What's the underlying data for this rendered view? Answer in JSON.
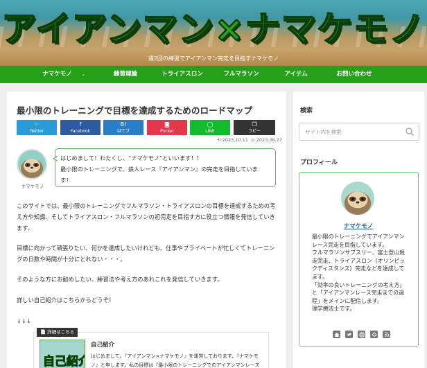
{
  "site": {
    "title": "アイアンマン×ナマケモノ",
    "tagline": "週2回の練習でアイアンマン完走を目指すナマケモノ"
  },
  "nav": {
    "items": [
      {
        "label": "ナマケモノ",
        "caret": "⌄"
      },
      {
        "label": "練習理論"
      },
      {
        "label": "トライアスロン"
      },
      {
        "label": "フルマラソン"
      },
      {
        "label": "アイテム"
      },
      {
        "label": "お問い合わせ"
      }
    ]
  },
  "post": {
    "title": "最小限のトレーニングで目標を達成するためのロードマップ",
    "share": [
      {
        "icon": "twitter-icon",
        "glyph": "🐦",
        "label": "Twitter",
        "color": "#2a9bd8"
      },
      {
        "icon": "facebook-icon",
        "glyph": "f",
        "label": "Facebook",
        "color": "#2d5aa0"
      },
      {
        "icon": "hatebu-icon",
        "glyph": "B!",
        "label": "はてブ",
        "color": "#2a7ec8"
      },
      {
        "icon": "pocket-icon",
        "glyph": "◙",
        "label": "Pocket",
        "color": "#e2374c"
      },
      {
        "icon": "line-icon",
        "glyph": "◯",
        "label": "LINE",
        "color": "#11bb2b"
      },
      {
        "icon": "copy-icon",
        "glyph": "❐",
        "label": "コピー",
        "color": "#333333"
      }
    ],
    "posted_date": "2023.10.11",
    "updated_date": "2023.08.27",
    "author_name": "ナマケモノ",
    "balloon_text_1": "はじめまして！わたくし、“ナマケモノ”といいます！！",
    "balloon_text_2": "最小限のトレーニングで、鉄人レース『アイアンマン』の完走を目指していま",
    "balloon_text_3": "す！",
    "paragraphs": [
      "このサイトでは、最小限のトレーニングでフルマラソン・トライアスロンの目標を達成するための考え方や知識、そしてトライアスロン・フルマラソンの初完走を目指す方に役立つ情報を発信していきます。",
      "目標に向かって頑張りたい、何かを達成したいけれども、仕事やプライベートが忙しくてトレーニングの日数や時間が十分にとれない・・・。",
      "そのような方にお勧めしたい、練習法や考え方のあれこれを発信していきます。",
      "詳しい自己紹介はこちらからどうぞ！",
      "↓↓↓"
    ],
    "blogcard": {
      "tag": "📄 詳細はこちら",
      "thumb_text": "自己紹介",
      "title": "自己紹介",
      "text": "はじめまして。『アイアンマン×ナマケモノ』を運営しております、『ナマケモノ』と申します。私の目標は『最小限のトレーニングでのアイアンマンレース"
    }
  },
  "sidebar": {
    "search_heading": "検索",
    "search_placeholder": "サイト内を検索",
    "profile_heading": "プロフィール",
    "profile_name": "ナマケモノ",
    "profile_desc": "最小限のトレーニングでアイアンマンレース完走を目指しています。\nフルマラソンサブスリー、富士登山競走完走、トライアスロン（オリンピックディスタンス）完走などを達成してます。\n「効率の良いトレーニングの考え方」と「アイアンマンレース完走までの過程」をメインに配信します。\n理学療法士です。",
    "socials": [
      "home-icon",
      "twitter-icon",
      "instagram-icon",
      "feedly-icon",
      "rss-icon"
    ]
  },
  "colors": {
    "brand_green": "#24a118",
    "balloon_border": "#56b85a",
    "link_blue": "#1c5fae"
  }
}
